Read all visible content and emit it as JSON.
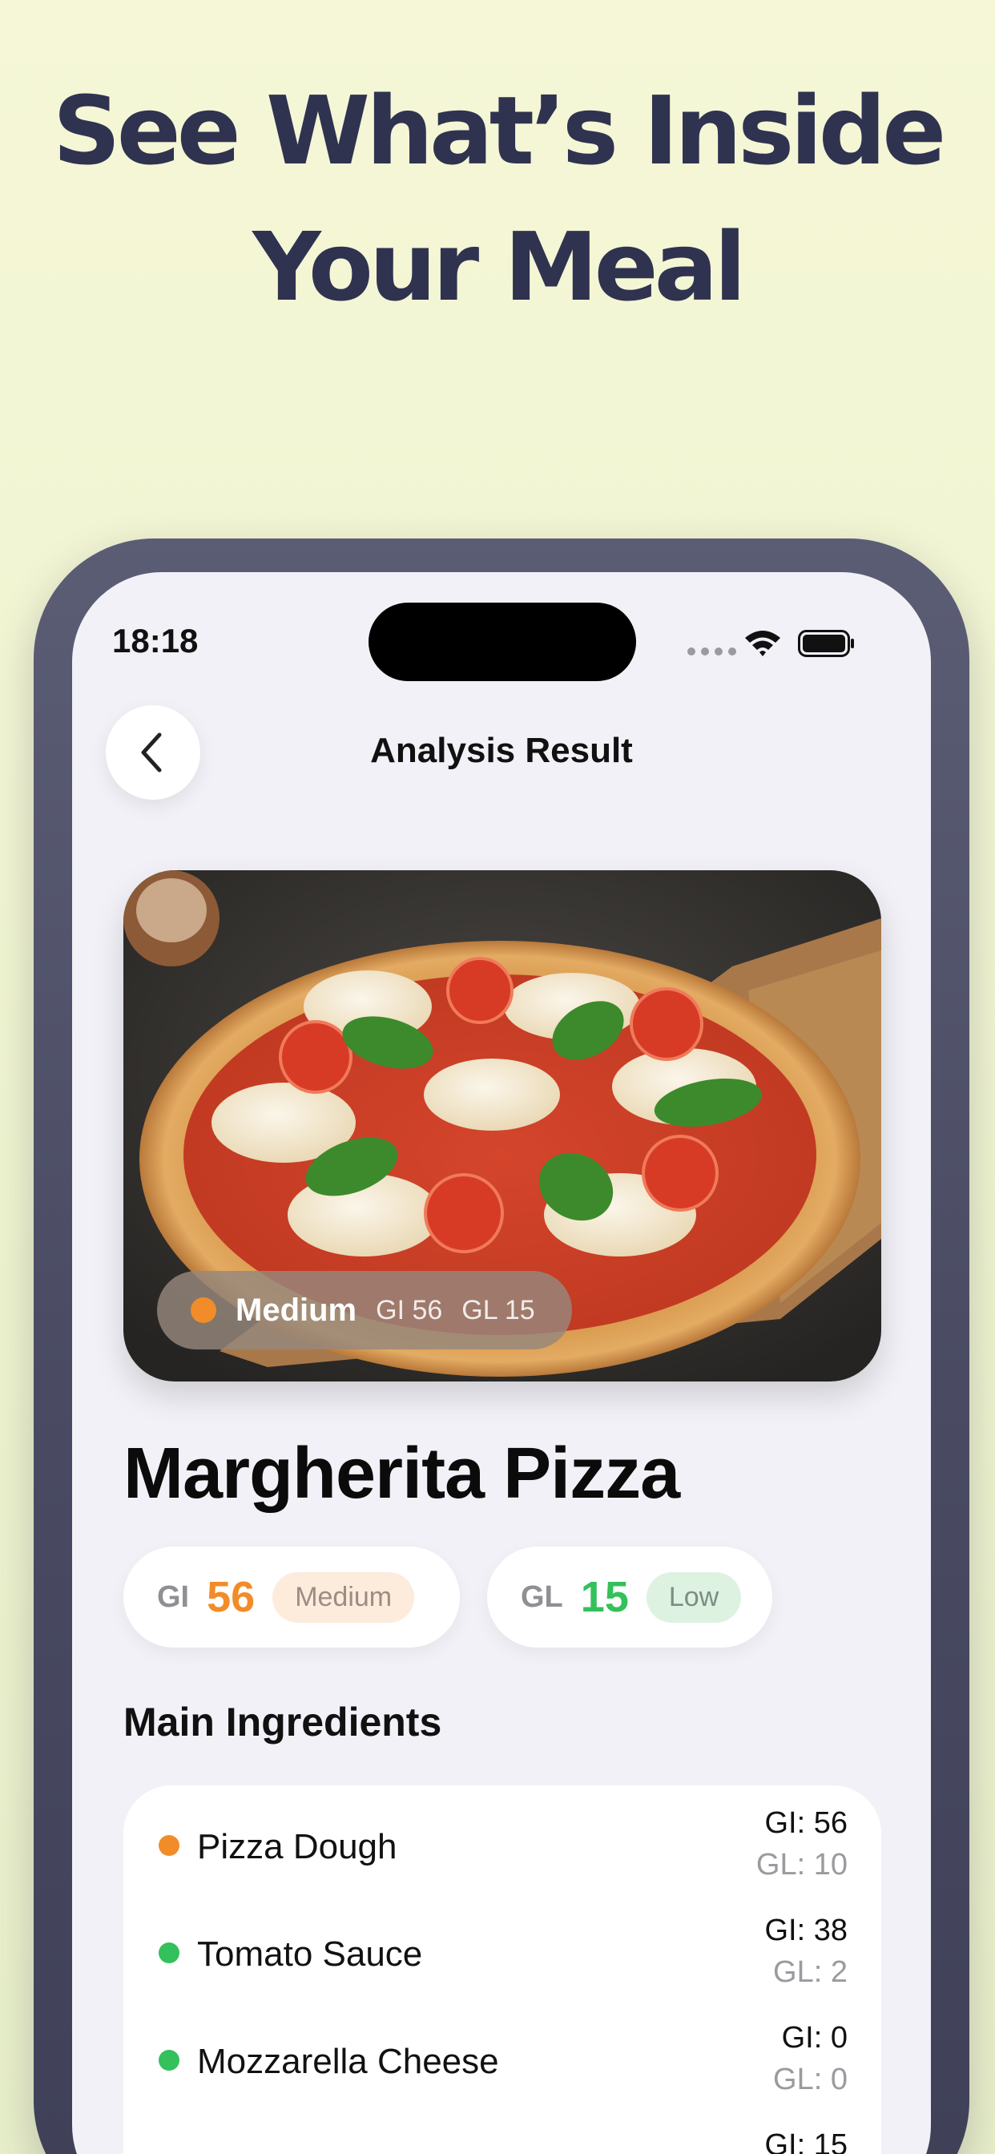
{
  "headline": {
    "line1": "See What’s Inside",
    "line2": "Your Meal"
  },
  "status_bar": {
    "time": "18:18"
  },
  "nav": {
    "title": "Analysis Result",
    "back_icon": "chevron-left-icon"
  },
  "food": {
    "image_subject": "pizza-photo",
    "overlay": {
      "level": "Medium",
      "gi": "GI 56",
      "gl": "GL 15",
      "level_color": "#f28c28"
    }
  },
  "dish": {
    "title": "Margherita Pizza"
  },
  "gi_pill": {
    "label": "GI",
    "value": "56",
    "tag": "Medium",
    "color": "#f28c28"
  },
  "gl_pill": {
    "label": "GL",
    "value": "15",
    "tag": "Low",
    "color": "#34c05a"
  },
  "ingredients": {
    "section_title": "Main Ingredients",
    "items": [
      {
        "name": "Pizza Dough",
        "gi": "GI: 56",
        "gl": "GL: 10",
        "color": "#f28c28"
      },
      {
        "name": "Tomato Sauce",
        "gi": "GI: 38",
        "gl": "GL: 2",
        "color": "#34c05a"
      },
      {
        "name": "Mozzarella Cheese",
        "gi": "GI: 0",
        "gl": "GL: 0",
        "color": "#34c05a"
      },
      {
        "name": "",
        "gi": "GI: 15",
        "gl": "",
        "color": "#34c05a"
      }
    ]
  }
}
